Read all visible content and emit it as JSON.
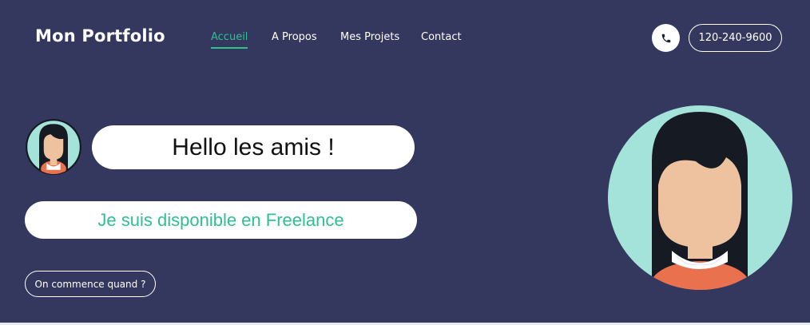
{
  "header": {
    "brand": "Mon Portfolio",
    "nav": [
      {
        "label": "Accueil",
        "active": true
      },
      {
        "label": "A Propos",
        "active": false
      },
      {
        "label": "Mes Projets",
        "active": false
      },
      {
        "label": "Contact",
        "active": false
      }
    ],
    "phone_icon": "phone-icon",
    "phone_number": "120-240-9600"
  },
  "hero": {
    "greeting": "Hello les amis !",
    "tagline": "Je suis disponible en Freelance",
    "cta_label": "On commence quand ?"
  },
  "colors": {
    "background": "#34385f",
    "accent": "#2fbf90",
    "avatar_bg": "#a4e3da",
    "hair": "#161a23",
    "skin": "#eec29e",
    "shirt": "#e9714e"
  }
}
